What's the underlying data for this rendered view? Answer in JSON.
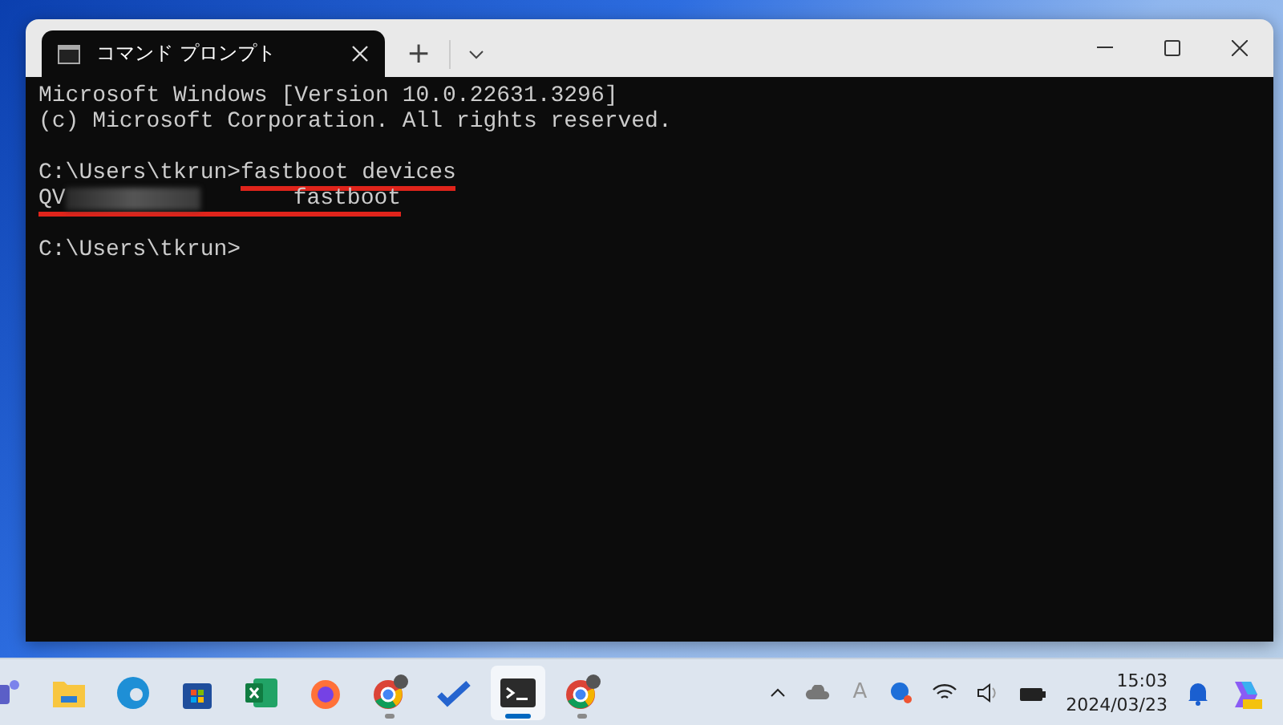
{
  "window": {
    "tab_title": "コマンド プロンプト",
    "new_tab": "+"
  },
  "terminal": {
    "lines": [
      {
        "kind": "text",
        "text": "Microsoft Windows [Version 10.0.22631.3296]"
      },
      {
        "kind": "text",
        "text": "(c) Microsoft Corporation. All rights reserved."
      },
      {
        "kind": "blank"
      },
      {
        "kind": "command",
        "prompt": "C:\\Users\\tkrun>",
        "command": "fastboot devices",
        "underlined": true
      },
      {
        "kind": "device",
        "serial": "QV",
        "status": "fastboot",
        "redacted": true,
        "underlined": true
      },
      {
        "kind": "blank"
      },
      {
        "kind": "command",
        "prompt": "C:\\Users\\tkrun>"
      }
    ]
  },
  "taskbar": {
    "apps": [
      {
        "kind": "teams",
        "running": false,
        "active": false
      },
      {
        "kind": "folder",
        "running": false,
        "active": false
      },
      {
        "kind": "edge",
        "running": false,
        "active": false
      },
      {
        "kind": "store",
        "running": false,
        "active": false
      },
      {
        "kind": "excel",
        "running": false,
        "active": false
      },
      {
        "kind": "firefox",
        "running": false,
        "active": false
      },
      {
        "kind": "chrome",
        "running": true,
        "active": false
      },
      {
        "kind": "todo",
        "running": false,
        "active": false
      },
      {
        "kind": "terminal",
        "running": true,
        "active": true
      },
      {
        "kind": "chrome",
        "running": true,
        "active": false
      }
    ],
    "ime_indicator": "A",
    "time": "15:03",
    "date": "2024/03/23"
  }
}
